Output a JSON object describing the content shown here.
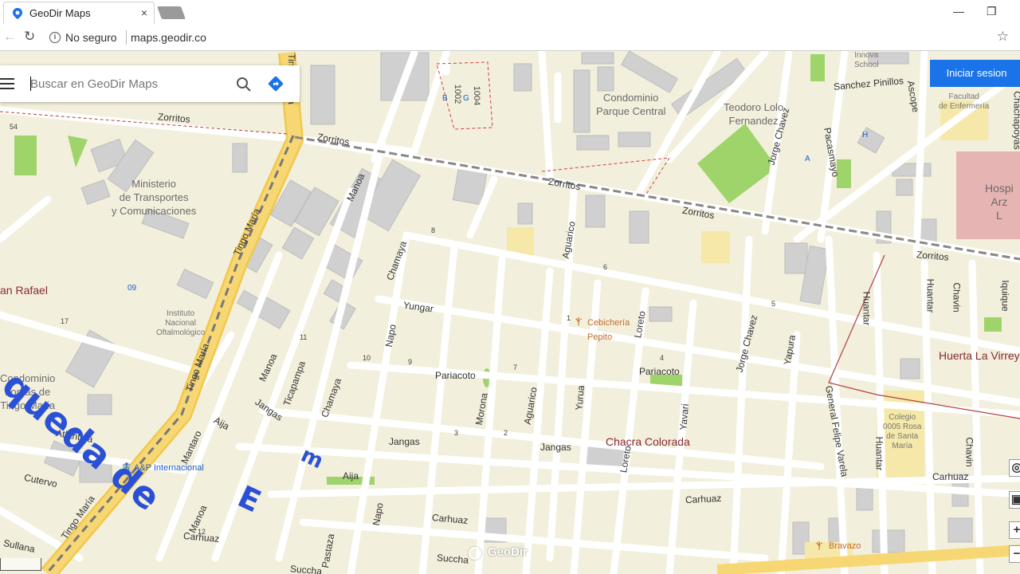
{
  "browser": {
    "tab_title": "GeoDir Maps",
    "tab_close": "×",
    "security_text": "No seguro",
    "url": "maps.geodir.co",
    "minimize": "—",
    "restore": "❐",
    "back": "←",
    "reload": "↻",
    "bookmark": "☆"
  },
  "search": {
    "placeholder": "Buscar en GeoDir Maps",
    "value": ""
  },
  "login_button": "Iniciar sesion",
  "map_controls": {
    "zoom_in": "+",
    "layers": "▣",
    "locate": "◎",
    "zoom_out": "−"
  },
  "watermark": "GeoDir",
  "overlay_text": {
    "part1": "queda de",
    "part2": "E",
    "part3": "m"
  },
  "streets": {
    "zorritos": "Zorritos",
    "tingo_maria": "Tingo María",
    "manoa": "Manoa",
    "chamaya": "Chamaya",
    "yungar": "Yungar",
    "napo": "Napo",
    "pariacoto": "Pariacoto",
    "jangas": "Jangas",
    "aguarico": "Aguarico",
    "loreto": "Loreto",
    "jorge_chavez": "Jorge Chavez",
    "yapura": "Yapura",
    "pacasmayo": "Pacasmayo",
    "ascope": "Ascope",
    "sanchez_pinillos": "Sanchez Pinillos",
    "huantar": "Huantar",
    "chavin": "Chavin",
    "iquique": "Iquique",
    "general_felipe_varela": "General Felipe Varela",
    "carhuaz": "Carhuaz",
    "aija": "Aija",
    "ticapampa": "Ticapampa",
    "mantaro": "Mantaro",
    "atlantida": "Atlantida",
    "cutervo": "Cutervo",
    "sullana": "Sullana",
    "succha": "Succha",
    "pastaza": "Pastaza",
    "morona": "Morona",
    "yurua": "Yurua",
    "yavari": "Yavari",
    "chachapoyas": "Chachapoyas"
  },
  "places": {
    "ministerio": "Ministerio\nde Transportes\ny Comunicaciones",
    "condominio_parque": "Condominio\nParque Central",
    "teodoro": "Teodoro Lolo\nFernandez",
    "instituto": "Instituto\nNacional\nOftalmológico",
    "condominio_lomas": "Condominio\nLomas de\nTingo María",
    "san_rafael": "an Rafael",
    "chacra": "Chacra Colorada",
    "huerta": "Huerta La Virrey",
    "cebicheria": "Cebichería\nPepito",
    "ap": "A&P Internacional",
    "colegio": "Colegio\n0005 Rosa\nde Santa\nMaría",
    "bravazo": "Bravazo",
    "innova": "Innova\nSchool",
    "facultad": "Facultad\nde Enfermería",
    "hospital": "Hospi\nArz\nL"
  },
  "house_numbers": [
    "54",
    "1002",
    "1004",
    "B",
    "G",
    "09",
    "17",
    "8",
    "6",
    "5",
    "4",
    "3",
    "2",
    "1",
    "9",
    "10",
    "11",
    "12",
    "7",
    "A",
    "H"
  ],
  "colors": {
    "map_bg": "#f2efdc",
    "road": "#ffffff",
    "main_road": "#f7d774",
    "block": "#cfcfcf",
    "park": "#9fd46b",
    "accent": "#1a73e8",
    "area_label": "#8a2a33",
    "big_text": "#2a50d6"
  }
}
